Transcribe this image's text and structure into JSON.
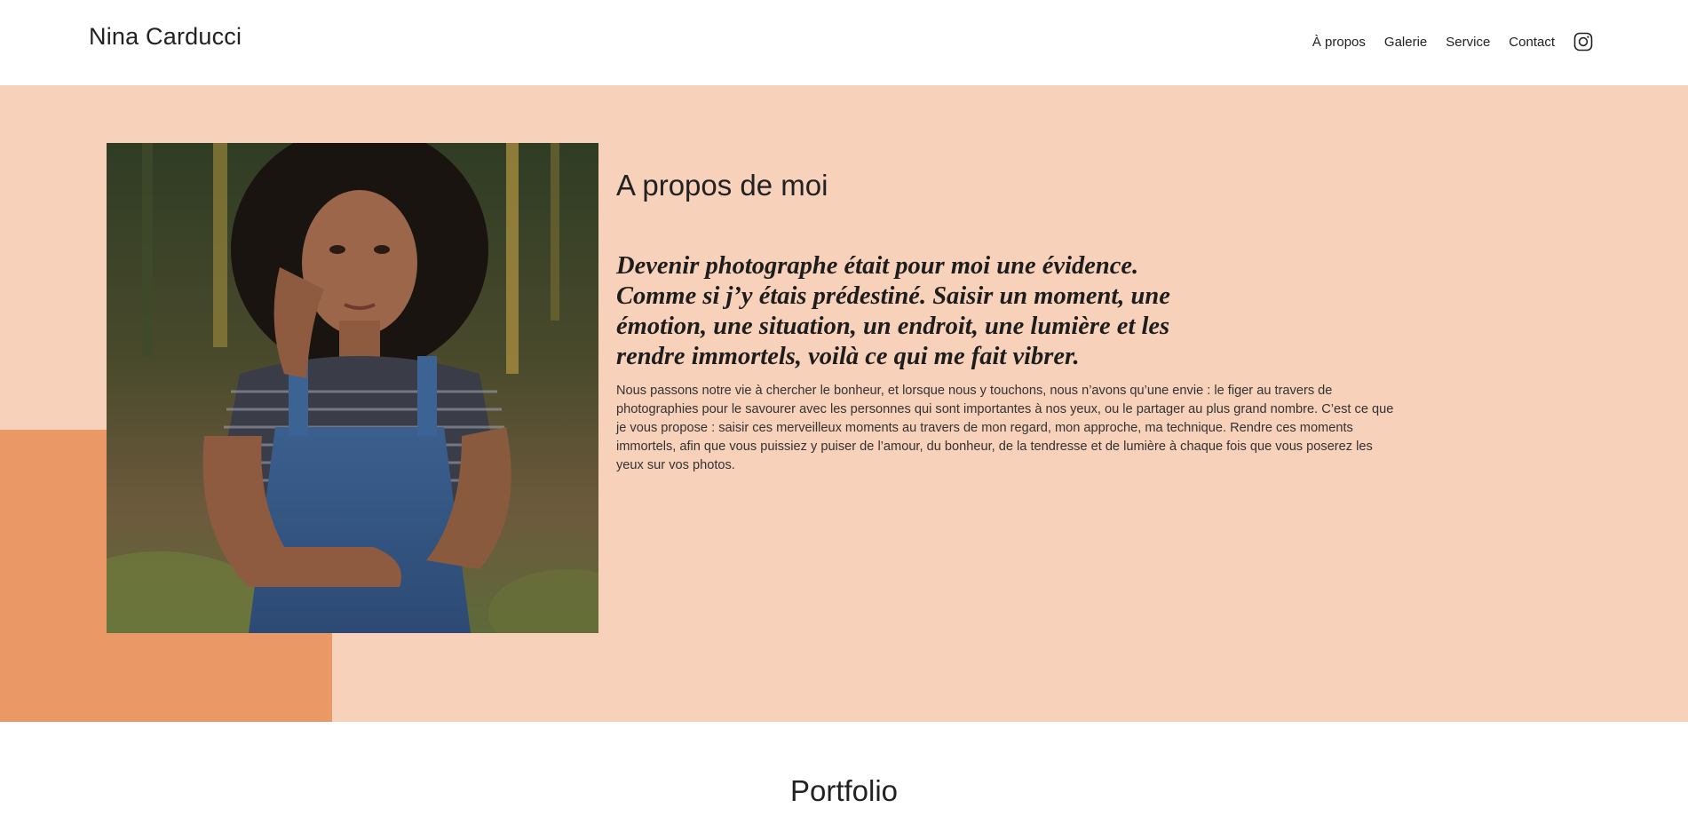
{
  "header": {
    "site_title": "Nina Carducci",
    "nav": [
      {
        "label": "À propos"
      },
      {
        "label": "Galerie"
      },
      {
        "label": "Service"
      },
      {
        "label": "Contact"
      }
    ],
    "social_icon": "instagram-icon"
  },
  "about": {
    "title": "A propos de moi",
    "quote": "Devenir photographe était pour moi une évidence. Comme si j’y étais prédestiné. Saisir un moment, une émotion, une situation, un endroit, une lumière et les rendre immortels, voilà ce qui me fait vibrer.",
    "body": "Nous passons notre vie à chercher le bonheur, et lorsque nous y touchons, nous n’avons qu’une envie : le figer au travers de photographies pour le savourer avec les personnes qui sont importantes à nos yeux, ou le partager au plus grand nombre. C’est ce que je vous propose : saisir ces merveilleux moments au travers de mon regard, mon approche, ma technique. Rendre ces moments immortels, afin que vous puissiez y puiser de l’amour, du bonheur, de la tendresse et de lumière à chaque fois que vous poserez les yeux sur vos photos.",
    "photo_icon": "portrait-photo"
  },
  "portfolio": {
    "title": "Portfolio"
  },
  "colors": {
    "about_background": "#f7d1b9",
    "accent_block": "#e99866",
    "text": "#222222",
    "header_background": "#ffffff"
  }
}
